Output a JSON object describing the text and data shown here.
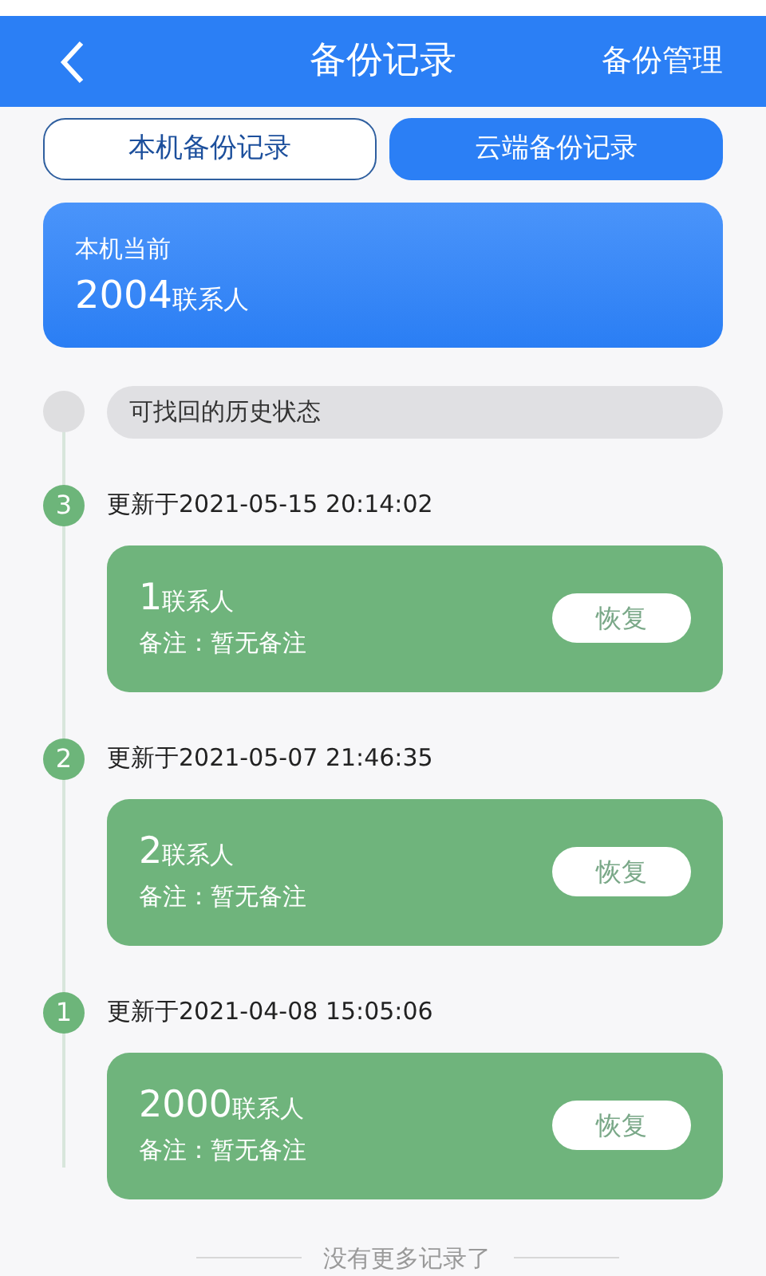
{
  "header": {
    "title": "备份记录",
    "action": "备份管理"
  },
  "tabs": [
    {
      "label": "本机备份记录",
      "selected": false
    },
    {
      "label": "云端备份记录",
      "selected": true
    }
  ],
  "current": {
    "label": "本机当前",
    "count": "2004",
    "unit": "联系人"
  },
  "history_title": "可找回的历史状态",
  "records": [
    {
      "index": "3",
      "updated": "更新于2021-05-15 20:14:02",
      "count": "1",
      "unit": "联系人",
      "note": "备注：暂无备注",
      "button": "恢复"
    },
    {
      "index": "2",
      "updated": "更新于2021-05-07 21:46:35",
      "count": "2",
      "unit": "联系人",
      "note": "备注：暂无备注",
      "button": "恢复"
    },
    {
      "index": "1",
      "updated": "更新于2021-04-08 15:05:06",
      "count": "2000",
      "unit": "联系人",
      "note": "备注：暂无备注",
      "button": "恢复"
    }
  ],
  "footer": "没有更多记录了"
}
